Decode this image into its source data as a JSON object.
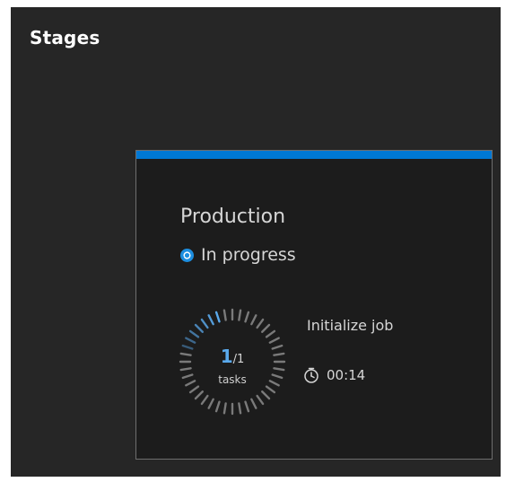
{
  "section": {
    "title": "Stages"
  },
  "stage": {
    "name": "Production",
    "status": "In progress",
    "accent_color": "#0078d4",
    "status_icon": "in-progress-icon",
    "tasks": {
      "completed": "1",
      "total": "/1",
      "label": "tasks",
      "progress_fraction": 0.17
    },
    "job": {
      "name": "Initialize job",
      "duration": "00:14",
      "duration_icon": "timer-icon"
    }
  }
}
